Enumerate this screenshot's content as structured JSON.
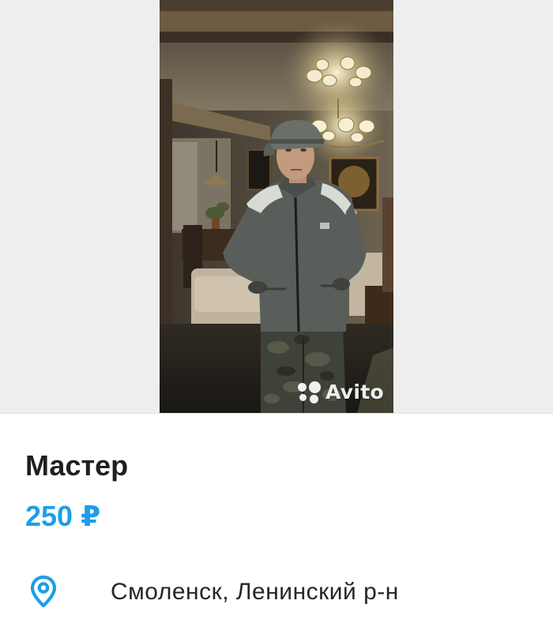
{
  "listing": {
    "title": "Мастер",
    "price": "250 ₽",
    "location": "Смоленск, Ленинский р-н"
  },
  "photo": {
    "watermark_text": "Avito",
    "watermark_icon": "avito-logo-dots"
  },
  "icons": {
    "location": "location-pin-icon"
  },
  "colors": {
    "price": "#1e9ee8",
    "pin": "#1e9ee8",
    "title": "#1f1f1f",
    "text": "#262626",
    "photo_backdrop": "#eeeeee"
  }
}
